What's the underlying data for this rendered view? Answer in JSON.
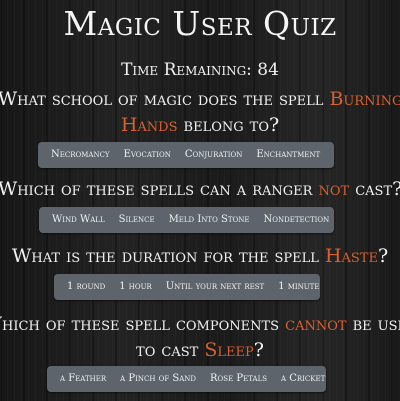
{
  "quiz": {
    "title": "Magic User Quiz",
    "timer": "Time Remaining: 84"
  },
  "questions": [
    {
      "line1_before": "What school of magic does the spell ",
      "line1_highlight": "Burning",
      "line2_highlight": "Hands",
      "line2_after": " belong to?",
      "options": [
        "Necromancy",
        "Evocation",
        "Conjuration",
        "Enchantment"
      ]
    },
    {
      "before": "Which of these spells can a ranger ",
      "highlight": "not",
      "after": " cast?",
      "options": [
        "Wind Wall",
        "Silence",
        "Meld Into Stone",
        "Nondetection"
      ]
    },
    {
      "before": "What is the duration for the spell ",
      "highlight": "Haste",
      "after": "?",
      "options": [
        "1 round",
        "1 hour",
        "Until your next rest",
        "1 minute"
      ]
    },
    {
      "line1_before": "Which of these spell components ",
      "line1_highlight": "cannot",
      "line1_after": " be used",
      "line2_before": "to cast ",
      "line2_highlight": "Sleep",
      "line2_after": "?",
      "options": [
        "a Feather",
        "a Pinch of Sand",
        "Rose Petals",
        "a Cricket"
      ]
    }
  ],
  "colors": {
    "highlight": "#d9602f",
    "option_bar": "#5d646b",
    "text": "#f2f2f2"
  }
}
